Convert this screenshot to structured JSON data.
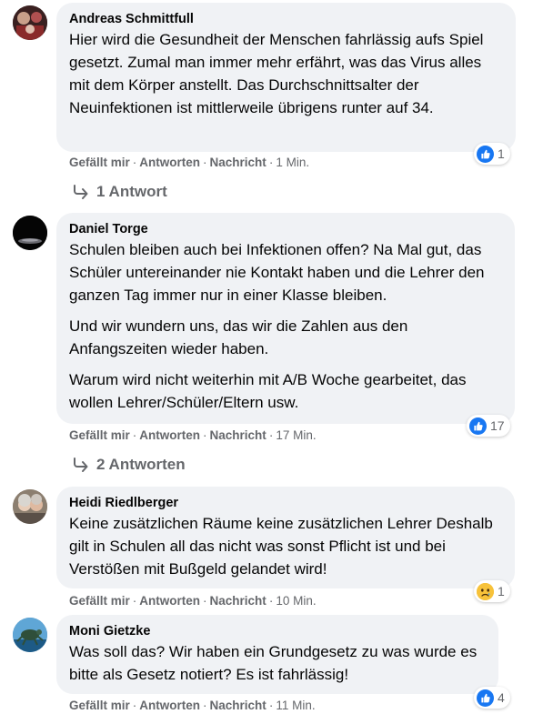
{
  "actions": {
    "like": "Gefällt mir",
    "reply": "Antworten",
    "message": "Nachricht",
    "separator": "·"
  },
  "colors": {
    "bubble": "#f0f2f5",
    "meta": "#65676b",
    "like_blue": "#1877f2",
    "sad_yellow": "#f7c23a"
  },
  "comments": [
    {
      "author": "Andreas Schmittfull",
      "paragraphs": [
        "Hier wird die Gesundheit der Menschen fahrlässig aufs Spiel gesetzt. Zumal man immer mehr erfährt, was das Virus alles mit dem Körper anstellt. Das Durchschnittsalter der Neuinfektionen ist mittlerweile übrigens runter auf 34."
      ],
      "time": "1 Min.",
      "reaction": {
        "icon": "like-icon",
        "count": "1"
      },
      "replies": "1 Antwort"
    },
    {
      "author": "Daniel Torge",
      "paragraphs": [
        "Schulen bleiben auch bei Infektionen offen? Na Mal gut, das Schüler untereinander nie Kontakt haben und die Lehrer den ganzen Tag immer nur in einer Klasse bleiben.",
        "Und wir wundern uns, das wir die Zahlen aus den Anfangszeiten wieder haben.",
        "Warum wird nicht weiterhin mit A/B Woche gearbeitet, das wollen Lehrer/Schüler/Eltern usw."
      ],
      "time": "17 Min.",
      "reaction": {
        "icon": "like-icon",
        "count": "17"
      },
      "replies": "2 Antworten"
    },
    {
      "author": "Heidi Riedlberger",
      "paragraphs": [
        "Keine zusätzlichen Räume keine zusätzlichen Lehrer Deshalb gilt in Schulen all das nicht was sonst Pflicht ist und bei Verstößen mit Bußgeld gelandet wird!"
      ],
      "time": "10 Min.",
      "reaction": {
        "icon": "sad-face-icon",
        "count": "1"
      }
    },
    {
      "author": "Moni Gietzke",
      "paragraphs": [
        "Was soll das? Wir haben ein Grundgesetz zu was wurde es bitte als Gesetz notiert? Es ist fahrlässig!"
      ],
      "time": "11 Min.",
      "reaction": {
        "icon": "like-icon",
        "count": "4"
      }
    }
  ]
}
